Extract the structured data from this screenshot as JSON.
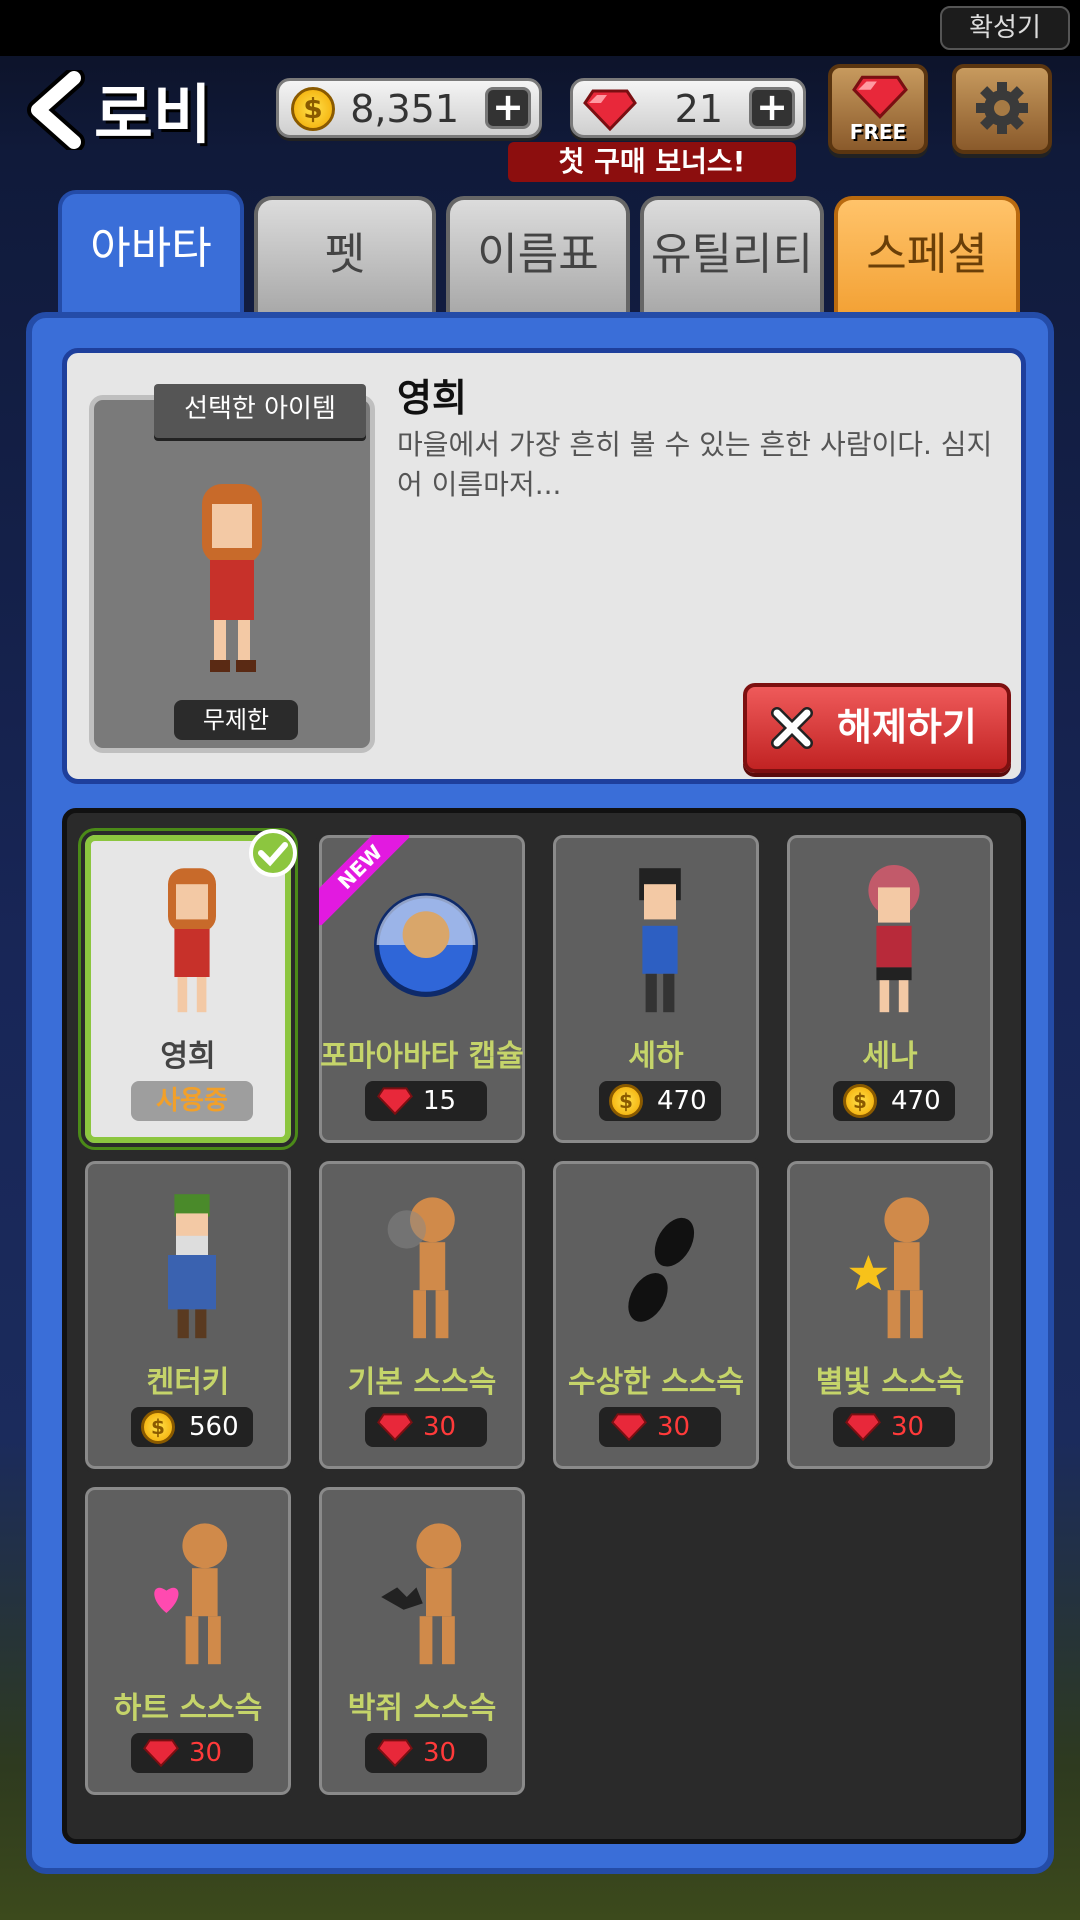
{
  "system": {
    "mega_label": "확성기"
  },
  "header": {
    "title": "로비",
    "coins": "8,351",
    "gems": "21",
    "bonus": "첫 구매 보너스!",
    "free_label": "FREE"
  },
  "tabs": [
    {
      "label": "아바타"
    },
    {
      "label": "펫"
    },
    {
      "label": "이름표"
    },
    {
      "label": "유틸리티"
    },
    {
      "label": "스페셜"
    }
  ],
  "selected": {
    "banner": "선택한 아이템",
    "name": "영희",
    "description": "마을에서 가장 흔히 볼 수 있는 흔한 사람이다. 심지어 이름마저...",
    "duration": "무제한",
    "unequip_label": "해제하기"
  },
  "items": [
    {
      "name": "영희",
      "status": "사용중"
    },
    {
      "name": "포마아바타 캡슐",
      "price": "15",
      "currency": "gem",
      "badge": "NEW"
    },
    {
      "name": "세하",
      "price": "470",
      "currency": "coin"
    },
    {
      "name": "세나",
      "price": "470",
      "currency": "coin"
    },
    {
      "name": "켄터키",
      "price": "560",
      "currency": "coin"
    },
    {
      "name": "기본 스스슥",
      "price": "30",
      "currency": "gem"
    },
    {
      "name": "수상한 스스슥",
      "price": "30",
      "currency": "gem"
    },
    {
      "name": "별빛 스스슥",
      "price": "30",
      "currency": "gem"
    },
    {
      "name": "하트 스스슥",
      "price": "30",
      "currency": "gem"
    },
    {
      "name": "박쥐 스스슥",
      "price": "30",
      "currency": "gem"
    }
  ],
  "colors": {
    "accent": "#3a6ed8",
    "gem": "#e8283a",
    "coin": "#f7c21a",
    "selected": "#8cc63f"
  }
}
